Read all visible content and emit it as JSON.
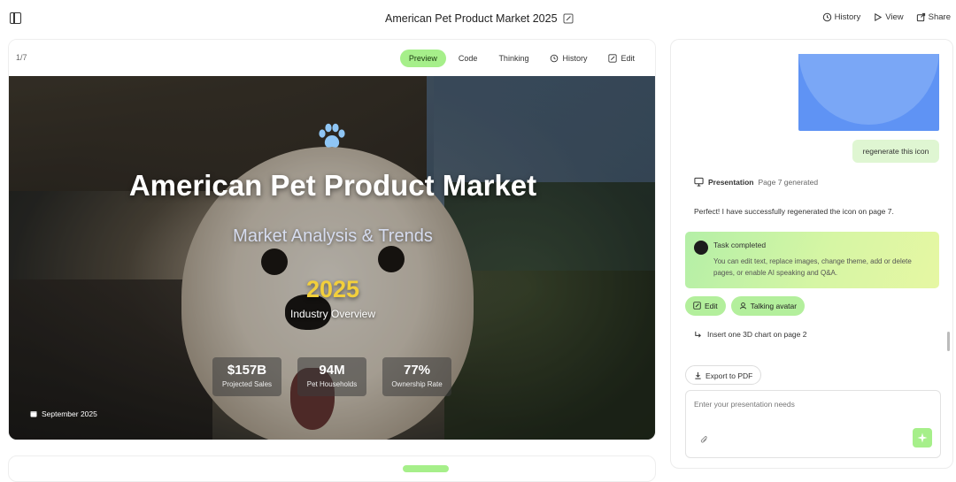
{
  "header": {
    "title": "American Pet Product Market 2025",
    "actions": [
      {
        "label": "History",
        "icon": "history-icon"
      },
      {
        "label": "View",
        "icon": "play-icon"
      },
      {
        "label": "Share",
        "icon": "share-icon"
      }
    ]
  },
  "slide_panel": {
    "page_indicator": "1/7",
    "tabs": [
      {
        "label": "Preview",
        "active": true
      },
      {
        "label": "Code"
      },
      {
        "label": "Thinking"
      },
      {
        "label": "History",
        "icon": "history-icon"
      },
      {
        "label": "Edit",
        "icon": "edit-icon"
      }
    ],
    "accent_color": "#a6ef8a"
  },
  "slide": {
    "icon": "paw-icon",
    "title": "American Pet Product Market",
    "subtitle": "Market Analysis & Trends",
    "year": "2025",
    "year_label": "Industry Overview",
    "stats": [
      {
        "value": "$157B",
        "label": "Projected Sales"
      },
      {
        "value": "94M",
        "label": "Pet Households"
      },
      {
        "value": "77%",
        "label": "Ownership Rate"
      }
    ],
    "date": "September 2025",
    "year_color": "#f2cf3c"
  },
  "chat": {
    "user_message": "regenerate this icon",
    "presentation_label": "Presentation",
    "presentation_status": "Page 7 generated",
    "assistant_message": "Perfect! I have successfully regenerated the icon on page 7.",
    "task": {
      "title": "Task completed",
      "description": "You can edit text, replace images, change theme, add or delete pages, or enable AI speaking and Q&A."
    },
    "chips": [
      {
        "label": "Edit",
        "icon": "edit-icon"
      },
      {
        "label": "Talking avatar",
        "icon": "avatar-icon"
      }
    ],
    "suggestion": "Insert one 3D chart on page 2",
    "export_label": "Export to PDF",
    "input_placeholder": "Enter your presentation needs"
  }
}
